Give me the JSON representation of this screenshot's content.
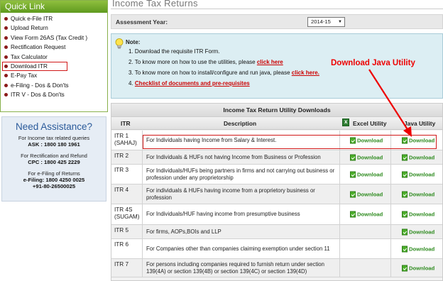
{
  "sidebar": {
    "quicklink_title": "Quick Link",
    "items": [
      {
        "label": "Quick e-File ITR"
      },
      {
        "label": "Upload Return"
      },
      {
        "label": "View Form 26AS (Tax Credit )"
      },
      {
        "label": "Rectification Request"
      },
      {
        "label": "Tax Calculator"
      },
      {
        "label": "Download ITR"
      },
      {
        "label": "E-Pay Tax"
      },
      {
        "label": "e-Filing - Dos & Don'ts"
      },
      {
        "label": "ITR V - Dos & Don'ts"
      }
    ],
    "assistance": {
      "title": "Need Assistance?",
      "q1": "For Income tax related queries",
      "q1_value": "ASK : 1800 180 1961",
      "q2": "For Rectification and Refund",
      "q2_value": "CPC : 1800 425 2229",
      "q3": "For e-Filing of Returns",
      "q3_value1": "e-Filing: 1800 4250 0025",
      "q3_value2": "+91-80-26500025"
    }
  },
  "main": {
    "title": "Income Tax Returns",
    "assessment_label": "Assessment Year:",
    "assessment_value": "2014-15",
    "note": {
      "label": "Note:",
      "line1": "1.  Download the requisite ITR Form.",
      "line2_text": "2.  To know more on how to use the utilities, please ",
      "line2_link": "click here",
      "line3_text": "3.  To know more on how to install/configure and run java, please ",
      "line3_link": "click here.",
      "line4_num": "4.  ",
      "line4_link": "Checklist of documents and pre-requisites"
    },
    "annotation": "Download Java Utility",
    "table": {
      "title": "Income Tax Return Utility Downloads",
      "headers": {
        "itr": "ITR",
        "desc": "Description",
        "excel": "Excel Utility",
        "java": "Java Utility"
      },
      "download_label": "Download",
      "rows": [
        {
          "itr": "ITR 1 (SAHAJ)",
          "desc": "For Individuals having Income from Salary & Interest.",
          "excel": true
        },
        {
          "itr": "ITR 2",
          "desc": "For Individuals & HUFs not having Income from Business or Profession",
          "excel": true
        },
        {
          "itr": "ITR 3",
          "desc": "For Individuals/HUFs being partners in firms and not carrying out business or profession under any proprietorship",
          "excel": true
        },
        {
          "itr": "ITR 4",
          "desc": "For individuals & HUFs having income from a proprietory business or profession",
          "excel": true
        },
        {
          "itr": "ITR 4S (SUGAM)",
          "desc": "For Individuals/HUF having income from presumptive business",
          "excel": true
        },
        {
          "itr": "ITR 5",
          "desc": "For firms, AOPs,BOIs and LLP",
          "excel": false
        },
        {
          "itr": "ITR 6",
          "desc": "For Companies other than companies claiming exemption under section 11",
          "excel": false
        },
        {
          "itr": "ITR 7",
          "desc": "For persons including companies required to furnish return under section 139(4A) or section 139(4B) or section 139(4C) or section 139(4D)",
          "excel": false
        }
      ]
    }
  },
  "colors": {
    "accent_green": "#5f9a1e",
    "annotation_red": "#e00000",
    "link_red": "#cc0000",
    "note_bg": "#dceef3"
  }
}
